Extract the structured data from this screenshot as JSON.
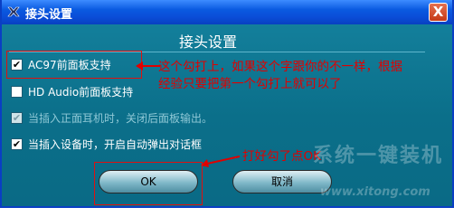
{
  "window": {
    "title": "接头设置",
    "close_label": "X"
  },
  "dialog": {
    "heading": "接头设置"
  },
  "options": [
    {
      "label": "AC97前面板支持",
      "checked": true,
      "enabled": true
    },
    {
      "label": "HD Audio前面板支持",
      "checked": false,
      "enabled": true
    },
    {
      "label": "当插入正面耳机时，关闭后面板输出。",
      "checked": true,
      "enabled": false
    },
    {
      "label": "当插入设备时，开启自动弹出对话框",
      "checked": true,
      "enabled": true
    }
  ],
  "annotations": {
    "top_line1": "这个勾打上，如果这个字跟你的不一样，根据",
    "top_line2": "经验只要把第一个勾打上就可以了",
    "ok_note": "打好勾了点OK"
  },
  "buttons": {
    "ok": "OK",
    "cancel": "取消"
  },
  "watermark": {
    "brand": "系统一键装机",
    "url": "www.xitong.com"
  },
  "colors": {
    "panel": "#0b7f9c",
    "titlebar": "#0a4dd8",
    "annotation": "#e00000"
  }
}
